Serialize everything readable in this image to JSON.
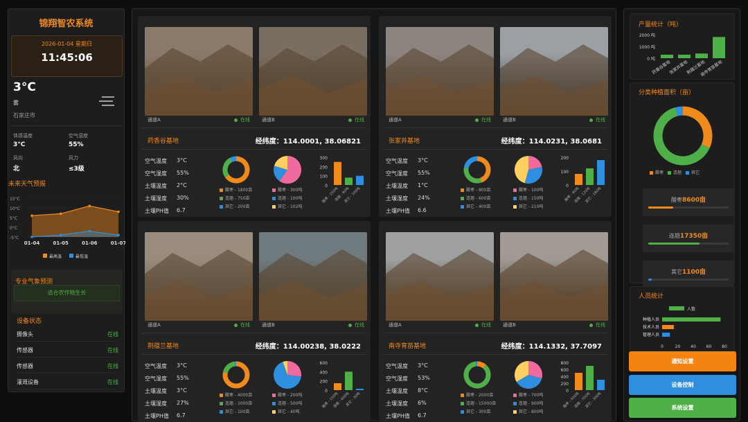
{
  "system_title": "锦翔智农系统",
  "date": "2026-01-04 星期日",
  "time": "11:45:06",
  "weather": {
    "temp": "3°C",
    "condition": "雾",
    "city": "石家庄市",
    "feels_label": "体感温度",
    "feels": "3°C",
    "humidity_label": "空气湿度",
    "humidity": "55%",
    "wind_dir_label": "风向",
    "wind_dir": "北",
    "wind_force_label": "风力",
    "wind_force": "≤3级"
  },
  "forecast": {
    "title": "未来天气预报",
    "yticks": [
      "15°C",
      "10°C",
      "5°C",
      "0°C",
      "-5°C"
    ],
    "dates": [
      "01-04",
      "01-05",
      "01-06",
      "01-07"
    ],
    "high": [
      6,
      7,
      11,
      8
    ],
    "low": [
      -5,
      -4,
      -2,
      -4
    ],
    "legend_high": "最高温",
    "legend_low": "最低温"
  },
  "pro": {
    "title": "专业气象预测",
    "text": "适合农作物生长"
  },
  "devices": {
    "title": "设备状态",
    "items": [
      {
        "name": "摄像头",
        "status": "在线"
      },
      {
        "name": "传感器",
        "status": "在线"
      },
      {
        "name": "传感器",
        "status": "在线"
      },
      {
        "name": "灌溉设备",
        "status": "在线"
      }
    ]
  },
  "sensor_labels": [
    "空气温度",
    "空气湿度",
    "土壤温度",
    "土壤湿度",
    "土壤PH值"
  ],
  "camera_a": "通道A",
  "camera_b": "通道B",
  "online": "在线",
  "bases": [
    {
      "name": "药香谷基地",
      "coord": "经纬度：114.0001, 38.06821",
      "sensors": [
        "3°C",
        "55%",
        "2°C",
        "30%",
        "6.7"
      ],
      "area_leg": [
        "酸枣 - 1800亩",
        "连翘 - 750亩",
        "其它 - 200亩"
      ],
      "area": [
        1800,
        750,
        200
      ],
      "yield_leg": [
        "酸枣 - 300吨",
        "连翘 - 100吨",
        "其它 - 102吨"
      ],
      "yield": [
        300,
        100,
        102
      ],
      "bar": {
        "yt": [
          "300",
          "200",
          "100",
          "0"
        ],
        "max": 300,
        "vals": [
          250,
          80,
          100
        ],
        "xl": [
          "酸枣 - 250吨",
          "连翘 - 80吨",
          "其它 - 100吨"
        ]
      }
    },
    {
      "name": "张家井基地",
      "coord": "经纬度：114.0231, 38.0681",
      "sensors": [
        "3°C",
        "55%",
        "1°C",
        "24%",
        "6.6"
      ],
      "area_leg": [
        "酸枣 - 800亩",
        "连翘 - 600亩",
        "其它 - 400亩"
      ],
      "area": [
        800,
        600,
        400
      ],
      "yield_leg": [
        "酸枣 - 100吨",
        "连翘 - 150吨",
        "其它 - 210吨"
      ],
      "yield": [
        100,
        150,
        210
      ],
      "bar": {
        "yt": [
          "200",
          "100",
          "0"
        ],
        "max": 200,
        "vals": [
          80,
          120,
          180
        ],
        "xl": [
          "酸枣 - 80吨",
          "连翘 - 120吨",
          "其它 - 180吨"
        ]
      }
    },
    {
      "name": "荆蕴兰基地",
      "coord": "经纬度：114.00238, 38.0222",
      "sensors": [
        "3°C",
        "55%",
        "3°C",
        "27%",
        "6.7"
      ],
      "area_leg": [
        "酸枣 - 4000亩",
        "连翘 - 1000亩",
        "其它 - 100亩"
      ],
      "area": [
        4000,
        1000,
        100
      ],
      "yield_leg": [
        "酸枣 - 200吨",
        "连翘 - 500吨",
        "其它 - 40吨"
      ],
      "yield": [
        200,
        500,
        40
      ],
      "bar": {
        "yt": [
          "600",
          "400",
          "200",
          "0"
        ],
        "max": 600,
        "vals": [
          150,
          400,
          30
        ],
        "xl": [
          "酸枣 - 150吨",
          "连翘 - 400吨",
          "其它 - 30吨"
        ]
      }
    },
    {
      "name": "南寺育苗基地",
      "coord": "经纬度：114.1332, 37.7097",
      "sensors": [
        "3°C",
        "53%",
        "8°C",
        "6%",
        "6.7"
      ],
      "area_leg": [
        "酸枣 - 2000亩",
        "连翘 - 15000亩",
        "其它 - 300亩"
      ],
      "area": [
        2000,
        15000,
        300
      ],
      "yield_leg": [
        "酸枣 - 700吨",
        "连翘 - 900吨",
        "其它 - 800吨"
      ],
      "yield": [
        700,
        900,
        800
      ],
      "bar": {
        "yt": [
          "800",
          "600",
          "400",
          "200",
          "0"
        ],
        "max": 800,
        "vals": [
          500,
          700,
          300
        ],
        "xl": [
          "酸枣 - 500吨",
          "连翘 - 700吨",
          "其它 - 300吨"
        ]
      }
    }
  ],
  "production": {
    "title": "产量统计（吨）",
    "yt": [
      "2000 吨",
      "1000 吨",
      "0 吨"
    ],
    "max": 2000,
    "vals": [
      300,
      300,
      400,
      1800
    ],
    "xl": [
      "药香谷基地",
      "张家井基地",
      "荆蕴兰基地",
      "南寺育苗基地"
    ]
  },
  "plant": {
    "title": "分类种植面积（亩）",
    "values": [
      8600,
      17350,
      1100
    ],
    "legend": [
      "酸枣",
      "连翘",
      "其它"
    ],
    "boxes": [
      {
        "label": "酸枣",
        "value": "8600亩",
        "pct": 0.31
      },
      {
        "label": "连翘",
        "value": "17350亩",
        "pct": 0.64
      },
      {
        "label": "其它",
        "value": "1100亩",
        "pct": 0.04
      }
    ]
  },
  "people": {
    "title": "人员统计",
    "legend": "人数",
    "labels": [
      "种植人员",
      "技术人员",
      "管理人员"
    ],
    "values": [
      75,
      15,
      10
    ],
    "xt": [
      "0",
      "20",
      "40",
      "60",
      "80"
    ],
    "max": 80
  },
  "buttons": [
    "通知设置",
    "设备控制",
    "系统设置"
  ],
  "colors": {
    "orange": "#f08a1c",
    "green": "#4fb04a",
    "blue": "#2e8fe0",
    "pink": "#f06aa0",
    "yellow": "#ffd060"
  }
}
